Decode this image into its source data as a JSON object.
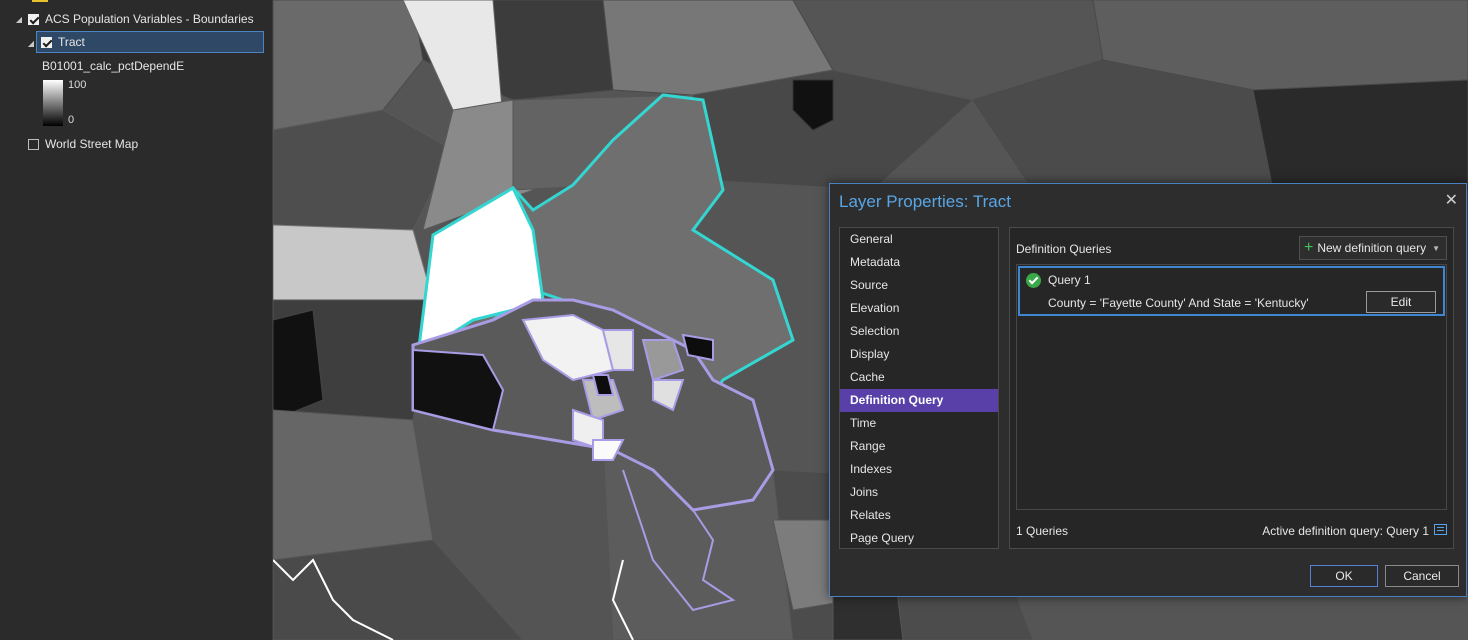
{
  "toc": {
    "group_label": "ACS Population Variables - Boundaries",
    "layer_label": "Tract",
    "field_label": "B01001_calc_pctDependE",
    "legend_max": "100",
    "legend_min": "0",
    "basemap_label": "World Street Map"
  },
  "dialog": {
    "title": "Layer Properties: Tract",
    "close": "✕",
    "nav_items": [
      "General",
      "Metadata",
      "Source",
      "Elevation",
      "Selection",
      "Display",
      "Cache",
      "Definition Query",
      "Time",
      "Range",
      "Indexes",
      "Joins",
      "Relates",
      "Page Query"
    ],
    "selected_item": "Definition Query",
    "heading": "Definition Queries",
    "new_button": "New definition query",
    "query_name": "Query 1",
    "query_expression": "County = 'Fayette County' And State = 'Kentucky'",
    "edit_button": "Edit",
    "count": "1 Queries",
    "active_query": "Active definition query: Query 1",
    "ok": "OK",
    "cancel": "Cancel"
  },
  "colors": {
    "accent_blue": "#59a6e6",
    "selection_purple": "#5840a8",
    "highlight_cyan": "#34d6d2",
    "tract_lavender": "#a99be4"
  }
}
